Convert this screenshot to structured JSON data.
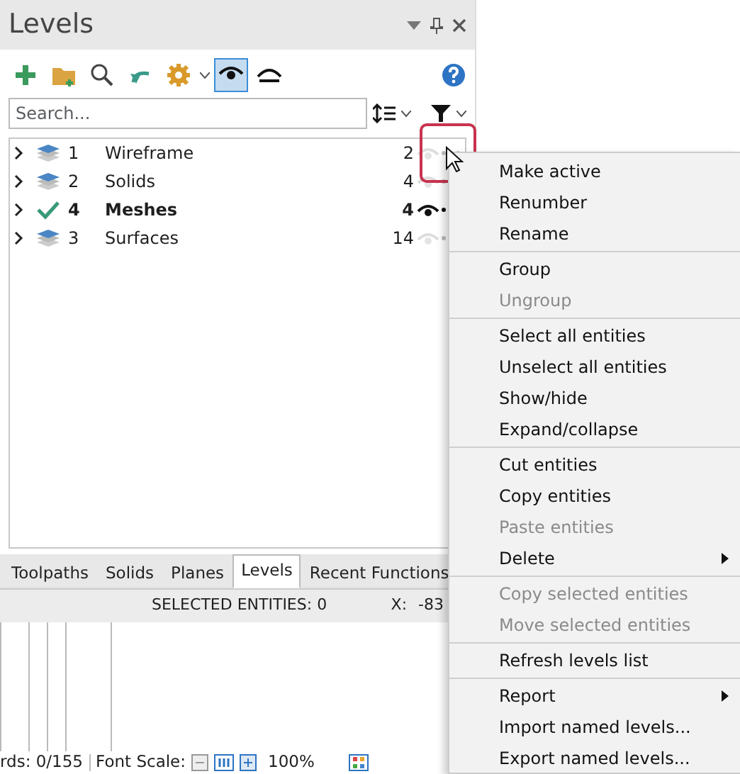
{
  "panel": {
    "title": "Levels",
    "toolbar": [
      {
        "kind": "add",
        "pressed": false
      },
      {
        "kind": "folder",
        "pressed": false
      },
      {
        "kind": "search",
        "pressed": false
      },
      {
        "kind": "undo",
        "pressed": false
      },
      {
        "kind": "gear",
        "pressed": false
      },
      {
        "kind": "eye",
        "pressed": true
      },
      {
        "kind": "eye-closed",
        "pressed": false
      }
    ],
    "search": {
      "placeholder": "Search..."
    },
    "levels": [
      {
        "number": "1",
        "name": "Wireframe",
        "count": "2",
        "active": false,
        "visible": false,
        "hovered": true
      },
      {
        "number": "2",
        "name": "Solids",
        "count": "4",
        "active": false,
        "visible": false,
        "hovered": false
      },
      {
        "number": "4",
        "name": "Meshes",
        "count": "4",
        "active": true,
        "visible": true,
        "hovered": false
      },
      {
        "number": "3",
        "name": "Surfaces",
        "count": "14",
        "active": false,
        "visible": false,
        "hovered": false
      }
    ],
    "tabs": [
      {
        "label": "Toolpaths",
        "selected": false
      },
      {
        "label": "Solids",
        "selected": false
      },
      {
        "label": "Planes",
        "selected": false
      },
      {
        "label": "Levels",
        "selected": true
      },
      {
        "label": "Recent Functions",
        "selected": false
      }
    ],
    "status": {
      "selected": "SELECTED ENTITIES: 0",
      "x_label": "X:",
      "x_value": "-83"
    }
  },
  "bottom_bar": {
    "records": "rds: 0/155",
    "font_scale_label": "Font Scale:",
    "zoom": "100%"
  },
  "context_menu": [
    [
      {
        "label": "Make active",
        "disabled": false,
        "submenu": false
      },
      {
        "label": "Renumber",
        "disabled": false,
        "submenu": false
      },
      {
        "label": "Rename",
        "disabled": false,
        "submenu": false
      }
    ],
    [
      {
        "label": "Group",
        "disabled": false,
        "submenu": false
      },
      {
        "label": "Ungroup",
        "disabled": true,
        "submenu": false
      }
    ],
    [
      {
        "label": "Select all entities",
        "disabled": false,
        "submenu": false
      },
      {
        "label": "Unselect all entities",
        "disabled": false,
        "submenu": false
      },
      {
        "label": "Show/hide",
        "disabled": false,
        "submenu": false
      },
      {
        "label": "Expand/collapse",
        "disabled": false,
        "submenu": false
      }
    ],
    [
      {
        "label": "Cut entities",
        "disabled": false,
        "submenu": false
      },
      {
        "label": "Copy entities",
        "disabled": false,
        "submenu": false
      },
      {
        "label": "Paste entities",
        "disabled": true,
        "submenu": false
      },
      {
        "label": "Delete",
        "disabled": false,
        "submenu": true
      }
    ],
    [
      {
        "label": "Copy selected entities",
        "disabled": true,
        "submenu": false
      },
      {
        "label": "Move selected entities",
        "disabled": true,
        "submenu": false
      }
    ],
    [
      {
        "label": "Refresh levels list",
        "disabled": false,
        "submenu": false
      }
    ],
    [
      {
        "label": "Report",
        "disabled": false,
        "submenu": true
      },
      {
        "label": "Import named levels...",
        "disabled": false,
        "submenu": false
      },
      {
        "label": "Export named levels...",
        "disabled": false,
        "submenu": false
      }
    ]
  ]
}
